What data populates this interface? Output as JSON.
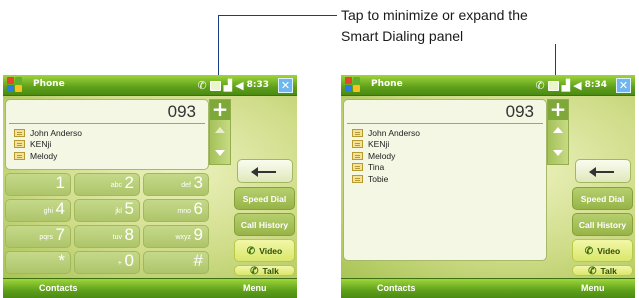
{
  "annotation": {
    "line1": "Tap to minimize or expand the",
    "line2": "Smart Dialing panel"
  },
  "screens": [
    {
      "title": "Phone",
      "time": "8:33",
      "number": "093",
      "plus": "+",
      "contacts": [
        "John Anderso",
        "KENji",
        "Melody"
      ],
      "keys": [
        {
          "digit": "1",
          "letters": ""
        },
        {
          "digit": "2",
          "letters": "abc"
        },
        {
          "digit": "3",
          "letters": "def"
        },
        {
          "digit": "4",
          "letters": "ghi"
        },
        {
          "digit": "5",
          "letters": "jkl"
        },
        {
          "digit": "6",
          "letters": "mno"
        },
        {
          "digit": "7",
          "letters": "pqrs"
        },
        {
          "digit": "8",
          "letters": "tuv"
        },
        {
          "digit": "9",
          "letters": "wxyz"
        },
        {
          "digit": "*",
          "letters": ""
        },
        {
          "digit": "0",
          "letters": "+"
        },
        {
          "digit": "#",
          "letters": ""
        }
      ],
      "buttons": {
        "speed_dial": "Speed Dial",
        "call_history": "Call History",
        "video": "Video",
        "talk": "Talk"
      },
      "softkeys": {
        "left": "Contacts",
        "right": "Menu"
      }
    },
    {
      "title": "Phone",
      "time": "8:34",
      "number": "093",
      "plus": "+",
      "contacts": [
        "John Anderso",
        "KENji",
        "Melody",
        "Tina",
        "Tobie"
      ],
      "buttons": {
        "speed_dial": "Speed Dial",
        "call_history": "Call History",
        "video": "Video",
        "talk": "Talk"
      },
      "softkeys": {
        "left": "Contacts",
        "right": "Menu"
      }
    }
  ],
  "icons": {
    "start": "windows-start-icon",
    "phone_status": "phone-icon",
    "signal": "signal-icon",
    "volume": "speaker-icon",
    "close": "close-icon",
    "back": "backspace-arrow-icon",
    "video": "video-call-icon",
    "talk": "handset-icon"
  },
  "colors": {
    "titlebar": "#5fa01b",
    "annotation_line": "#1a3a8a",
    "close_button": "#6fb6f0"
  }
}
